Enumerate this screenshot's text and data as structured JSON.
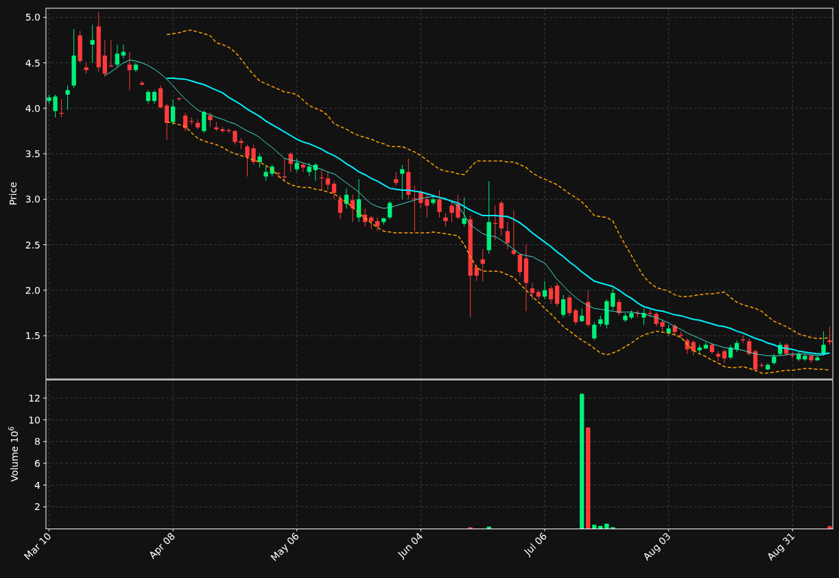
{
  "price_panel": {
    "chart_data": {
      "type": "candlestick",
      "ylabel": "Price",
      "grid": true,
      "ylim": [
        1.025,
        5.1
      ],
      "categories": [
        null,
        null,
        null,
        null,
        null,
        null,
        null,
        null,
        null,
        null,
        null,
        null,
        null,
        null,
        null,
        null,
        null,
        null,
        null,
        null,
        null,
        null,
        null,
        null,
        null,
        null,
        null,
        null,
        null,
        null,
        null,
        null,
        null,
        null,
        null,
        null,
        null,
        null,
        null,
        null,
        null,
        null,
        null,
        null,
        null,
        null,
        null,
        null,
        null,
        null,
        null,
        null,
        null,
        null,
        null,
        null,
        null,
        null,
        null,
        null,
        null,
        null,
        null,
        null,
        null,
        null,
        null,
        null,
        null,
        null,
        null,
        null,
        null,
        null,
        null,
        null,
        null,
        null,
        null,
        null,
        null,
        null,
        null,
        null,
        null,
        null,
        null,
        null,
        null,
        null,
        null,
        null,
        null,
        null,
        null,
        null,
        null,
        null,
        null,
        null,
        null,
        null,
        null,
        null,
        null,
        null,
        null,
        null,
        null,
        null,
        null,
        null,
        null,
        null,
        null,
        null,
        null,
        null,
        null,
        null,
        null,
        null,
        null,
        null,
        null,
        null,
        null
      ],
      "yticks": [
        {
          "value": 1.5,
          "label": "1.5"
        },
        {
          "value": 2,
          "label": "2.0"
        },
        {
          "value": 2.5,
          "label": "2.5"
        },
        {
          "value": 3,
          "label": "3.0"
        },
        {
          "value": 3.5,
          "label": "3.5"
        },
        {
          "value": 4,
          "label": "4.0"
        },
        {
          "value": 4.5,
          "label": "4.5"
        },
        {
          "value": 5,
          "label": "5.0"
        }
      ],
      "ohlc": [
        [
          4.08,
          4.15,
          4.05,
          4.12
        ],
        [
          3.97,
          4.15,
          3.9,
          4.13
        ],
        [
          3.95,
          4.1,
          3.9,
          3.94
        ],
        [
          4.15,
          4.25,
          3.98,
          4.2
        ],
        [
          4.25,
          4.87,
          4.22,
          4.58
        ],
        [
          4.8,
          4.85,
          4.5,
          4.52
        ],
        [
          4.45,
          4.5,
          4.38,
          4.42
        ],
        [
          4.7,
          4.92,
          4.5,
          4.75
        ],
        [
          4.9,
          5.06,
          4.4,
          4.45
        ],
        [
          4.58,
          4.75,
          4.35,
          4.38
        ],
        [
          4.47,
          4.75,
          4.45,
          4.46
        ],
        [
          4.48,
          4.7,
          4.45,
          4.6
        ],
        [
          4.58,
          4.7,
          4.55,
          4.62
        ],
        [
          4.48,
          4.62,
          4.2,
          4.42
        ],
        [
          4.42,
          4.5,
          4.4,
          4.48
        ],
        [
          4.28,
          4.3,
          4.25,
          4.26
        ],
        [
          4.08,
          4.2,
          4.05,
          4.18
        ],
        [
          4.08,
          4.2,
          4.05,
          4.18
        ],
        [
          4.22,
          4.25,
          4.0,
          4.01
        ],
        [
          4.03,
          4.05,
          3.65,
          3.84
        ],
        [
          3.85,
          4.1,
          3.82,
          4.02
        ],
        [
          4.11,
          4.12,
          4.08,
          4.1
        ],
        [
          3.92,
          3.95,
          3.75,
          3.78
        ],
        [
          3.86,
          3.9,
          3.82,
          3.85
        ],
        [
          3.84,
          3.88,
          3.77,
          3.79
        ],
        [
          3.75,
          3.98,
          3.73,
          3.96
        ],
        [
          3.92,
          3.95,
          3.8,
          3.87
        ],
        [
          3.79,
          3.85,
          3.75,
          3.77
        ],
        [
          3.77,
          3.8,
          3.73,
          3.75
        ],
        [
          3.76,
          3.78,
          3.73,
          3.75
        ],
        [
          3.75,
          3.76,
          3.6,
          3.63
        ],
        [
          3.64,
          3.67,
          3.55,
          3.62
        ],
        [
          3.58,
          3.6,
          3.25,
          3.47
        ],
        [
          3.56,
          3.6,
          3.38,
          3.41
        ],
        [
          3.41,
          3.5,
          3.35,
          3.47
        ],
        [
          3.25,
          3.38,
          3.2,
          3.3
        ],
        [
          3.28,
          3.38,
          3.25,
          3.36
        ],
        [
          3.29,
          3.3,
          3.23,
          3.28
        ],
        [
          3.25,
          3.45,
          3.2,
          3.24
        ],
        [
          3.5,
          3.52,
          3.3,
          3.39
        ],
        [
          3.33,
          3.45,
          3.3,
          3.4
        ],
        [
          3.38,
          3.4,
          3.3,
          3.35
        ],
        [
          3.3,
          3.4,
          3.25,
          3.36
        ],
        [
          3.32,
          3.4,
          3.2,
          3.38
        ],
        [
          3.24,
          3.33,
          3.1,
          3.23
        ],
        [
          3.23,
          3.3,
          3.1,
          3.16
        ],
        [
          3.17,
          3.2,
          3.0,
          3.07
        ],
        [
          3.0,
          3.05,
          2.78,
          2.85
        ],
        [
          2.95,
          3.12,
          2.9,
          3.05
        ],
        [
          2.99,
          3.05,
          2.75,
          2.9
        ],
        [
          2.8,
          3.22,
          2.75,
          3.0
        ],
        [
          2.83,
          2.9,
          2.7,
          2.75
        ],
        [
          2.8,
          2.82,
          2.67,
          2.76
        ],
        [
          2.76,
          2.8,
          2.65,
          2.7
        ],
        [
          2.75,
          2.8,
          2.72,
          2.79
        ],
        [
          2.8,
          2.98,
          2.78,
          2.96
        ],
        [
          3.22,
          3.3,
          3.15,
          3.18
        ],
        [
          3.28,
          3.38,
          3.0,
          3.33
        ],
        [
          3.3,
          3.45,
          3.0,
          3.05
        ],
        [
          3.01,
          3.15,
          2.65,
          3.0
        ],
        [
          3.08,
          3.1,
          2.9,
          2.96
        ],
        [
          3.0,
          3.05,
          2.8,
          2.93
        ],
        [
          2.96,
          3.05,
          2.94,
          3.0
        ],
        [
          3.0,
          3.1,
          2.8,
          2.86
        ],
        [
          2.8,
          2.85,
          2.7,
          2.76
        ],
        [
          2.93,
          2.98,
          2.75,
          2.85
        ],
        [
          2.95,
          3.05,
          2.78,
          2.8
        ],
        [
          2.73,
          3.02,
          2.7,
          2.79
        ],
        [
          2.78,
          2.82,
          1.7,
          2.16
        ],
        [
          2.25,
          2.28,
          2.1,
          2.16
        ],
        [
          2.34,
          2.45,
          2.1,
          2.29
        ],
        [
          2.44,
          3.2,
          2.4,
          2.75
        ],
        [
          2.74,
          2.93,
          2.55,
          2.73
        ],
        [
          2.96,
          2.98,
          2.6,
          2.68
        ],
        [
          2.65,
          2.75,
          2.45,
          2.52
        ],
        [
          2.44,
          2.88,
          2.38,
          2.4
        ],
        [
          2.39,
          2.4,
          2.15,
          2.2
        ],
        [
          2.35,
          2.5,
          1.77,
          2.08
        ],
        [
          2.02,
          2.08,
          1.9,
          1.97
        ],
        [
          1.98,
          2.0,
          1.9,
          1.93
        ],
        [
          1.93,
          2.1,
          1.9,
          2.0
        ],
        [
          2.02,
          2.05,
          1.85,
          1.9
        ],
        [
          2.05,
          2.08,
          1.82,
          1.85
        ],
        [
          1.73,
          1.95,
          1.7,
          1.9
        ],
        [
          1.92,
          1.95,
          1.72,
          1.75
        ],
        [
          1.78,
          1.8,
          1.62,
          1.65
        ],
        [
          1.66,
          1.8,
          1.65,
          1.72
        ],
        [
          1.87,
          2.0,
          1.6,
          1.62
        ],
        [
          1.47,
          1.65,
          1.45,
          1.62
        ],
        [
          1.63,
          1.72,
          1.6,
          1.68
        ],
        [
          1.62,
          1.9,
          1.58,
          1.88
        ],
        [
          1.82,
          2.02,
          1.78,
          1.97
        ],
        [
          1.87,
          1.9,
          1.72,
          1.75
        ],
        [
          1.67,
          1.75,
          1.65,
          1.72
        ],
        [
          1.7,
          1.78,
          1.68,
          1.75
        ],
        [
          1.75,
          1.78,
          1.7,
          1.74
        ],
        [
          1.7,
          1.8,
          1.62,
          1.75
        ],
        [
          1.75,
          1.8,
          1.7,
          1.74
        ],
        [
          1.74,
          1.76,
          1.6,
          1.63
        ],
        [
          1.65,
          1.68,
          1.55,
          1.6
        ],
        [
          1.53,
          1.62,
          1.5,
          1.58
        ],
        [
          1.61,
          1.63,
          1.5,
          1.54
        ],
        [
          1.51,
          1.55,
          1.47,
          1.5
        ],
        [
          1.45,
          1.47,
          1.3,
          1.35
        ],
        [
          1.43,
          1.45,
          1.28,
          1.33
        ],
        [
          1.34,
          1.4,
          1.3,
          1.37
        ],
        [
          1.36,
          1.43,
          1.35,
          1.4
        ],
        [
          1.4,
          1.42,
          1.3,
          1.32
        ],
        [
          1.3,
          1.33,
          1.22,
          1.27
        ],
        [
          1.33,
          1.35,
          1.2,
          1.25
        ],
        [
          1.26,
          1.4,
          1.24,
          1.37
        ],
        [
          1.35,
          1.45,
          1.32,
          1.42
        ],
        [
          1.46,
          1.5,
          1.42,
          1.45
        ],
        [
          1.44,
          1.47,
          1.28,
          1.3
        ],
        [
          1.33,
          1.35,
          1.1,
          1.13
        ],
        [
          1.18,
          1.2,
          1.15,
          1.17
        ],
        [
          1.13,
          1.2,
          1.12,
          1.18
        ],
        [
          1.2,
          1.3,
          1.18,
          1.27
        ],
        [
          1.3,
          1.43,
          1.28,
          1.4
        ],
        [
          1.4,
          1.42,
          1.28,
          1.3
        ],
        [
          1.29,
          1.32,
          1.25,
          1.28
        ],
        [
          1.24,
          1.32,
          1.22,
          1.3
        ],
        [
          1.24,
          1.3,
          1.22,
          1.28
        ],
        [
          1.28,
          1.3,
          1.2,
          1.23
        ],
        [
          1.23,
          1.28,
          1.22,
          1.26
        ],
        [
          1.3,
          1.55,
          1.28,
          1.4
        ],
        [
          1.45,
          1.6,
          1.4,
          1.43
        ]
      ],
      "series": [
        {
          "type": "line",
          "color": "#40e0d0",
          "values": [
            null,
            null,
            null,
            null,
            null,
            null,
            null,
            null,
            null,
            4.36,
            4.4,
            4.45,
            4.5,
            4.53,
            4.52,
            4.5,
            4.47,
            4.43,
            4.38,
            4.32,
            4.25,
            4.17,
            4.1,
            4.04,
            3.98,
            3.95,
            3.93,
            3.9,
            3.88,
            3.85,
            3.83,
            3.79,
            3.75,
            3.72,
            3.68,
            3.62,
            3.57,
            3.51,
            3.45,
            3.43,
            3.42,
            3.4,
            3.38,
            3.35,
            3.33,
            3.3,
            3.28,
            3.23,
            3.18,
            3.13,
            3.08,
            3.01,
            2.95,
            2.92,
            2.9,
            2.91,
            2.93,
            2.95,
            2.97,
            2.99,
            3.01,
            3.02,
            3.03,
            3.02,
            3.01,
            2.97,
            2.93,
            2.83,
            2.72,
            2.67,
            2.62,
            2.6,
            2.59,
            2.55,
            2.5,
            2.45,
            2.4,
            2.38,
            2.37,
            2.33,
            2.3,
            2.21,
            2.12,
            2.05,
            1.98,
            1.92,
            1.87,
            1.83,
            1.8,
            1.79,
            1.78,
            1.77,
            1.76,
            1.76,
            1.76,
            1.75,
            1.74,
            1.72,
            1.7,
            1.67,
            1.64,
            1.6,
            1.57,
            1.53,
            1.5,
            1.47,
            1.44,
            1.41,
            1.39,
            1.37,
            1.36,
            1.35,
            1.34,
            1.32,
            1.3,
            1.29,
            1.28,
            1.28,
            1.28,
            1.29,
            1.3,
            1.3,
            1.3,
            1.29,
            1.28,
            1.29,
            1.31
          ]
        },
        {
          "type": "line",
          "color": "#00f0ff",
          "values": [
            null,
            null,
            null,
            null,
            null,
            null,
            null,
            null,
            null,
            null,
            null,
            null,
            null,
            null,
            null,
            null,
            null,
            null,
            null,
            4.33,
            4.33,
            4.325,
            4.32,
            4.3,
            4.28,
            4.26,
            4.23,
            4.2,
            4.17,
            4.12,
            4.08,
            4.04,
            3.99,
            3.95,
            3.91,
            3.86,
            3.82,
            3.78,
            3.74,
            3.7,
            3.66,
            3.63,
            3.61,
            3.58,
            3.55,
            3.51,
            3.48,
            3.44,
            3.39,
            3.35,
            3.3,
            3.27,
            3.23,
            3.2,
            3.16,
            3.12,
            3.11,
            3.1,
            3.1,
            3.09,
            3.08,
            3.06,
            3.04,
            3.02,
            3.0,
            2.98,
            2.96,
            2.92,
            2.88,
            2.85,
            2.82,
            2.82,
            2.82,
            2.815,
            2.81,
            2.78,
            2.74,
            2.69,
            2.63,
            2.58,
            2.53,
            2.48,
            2.42,
            2.37,
            2.31,
            2.26,
            2.2,
            2.15,
            2.1,
            2.08,
            2.06,
            2.04,
            2.0,
            1.95,
            1.91,
            1.86,
            1.82,
            1.8,
            1.78,
            1.77,
            1.75,
            1.73,
            1.72,
            1.7,
            1.68,
            1.67,
            1.65,
            1.63,
            1.61,
            1.6,
            1.58,
            1.55,
            1.53,
            1.5,
            1.47,
            1.45,
            1.42,
            1.4,
            1.37,
            1.36,
            1.35,
            1.33,
            1.32,
            1.31,
            1.3,
            1.3,
            1.31
          ]
        },
        {
          "type": "line",
          "color": "#ffa500",
          "line_style": "dashed",
          "values": [
            null,
            null,
            null,
            null,
            null,
            null,
            null,
            null,
            null,
            null,
            null,
            null,
            null,
            null,
            null,
            null,
            null,
            null,
            null,
            4.81,
            4.82,
            4.83,
            4.85,
            4.86,
            4.84,
            4.82,
            4.8,
            4.72,
            4.7,
            4.67,
            4.62,
            4.54,
            4.45,
            4.37,
            4.3,
            4.27,
            4.24,
            4.21,
            4.18,
            4.17,
            4.15,
            4.09,
            4.03,
            4.0,
            3.97,
            3.92,
            3.83,
            3.8,
            3.77,
            3.73,
            3.7,
            3.68,
            3.66,
            3.63,
            3.61,
            3.58,
            3.58,
            3.58,
            3.55,
            3.52,
            3.48,
            3.43,
            3.38,
            3.33,
            3.31,
            3.3,
            3.28,
            3.27,
            3.35,
            3.42,
            3.42,
            3.42,
            3.42,
            3.42,
            3.41,
            3.41,
            3.38,
            3.35,
            3.29,
            3.25,
            3.22,
            3.19,
            3.16,
            3.11,
            3.06,
            3.02,
            2.97,
            2.9,
            2.82,
            2.81,
            2.8,
            2.76,
            2.62,
            2.5,
            2.38,
            2.26,
            2.15,
            2.08,
            2.03,
            2.01,
            1.99,
            1.95,
            1.93,
            1.93,
            1.94,
            1.95,
            1.96,
            1.96,
            1.97,
            1.98,
            1.92,
            1.87,
            1.84,
            1.82,
            1.8,
            1.77,
            1.71,
            1.66,
            1.63,
            1.6,
            1.56,
            1.52,
            1.5,
            1.48,
            1.47,
            1.47,
            1.48
          ]
        },
        {
          "type": "line",
          "color": "#ffa500",
          "line_style": "dashed",
          "values": [
            null,
            null,
            null,
            null,
            null,
            null,
            null,
            null,
            null,
            null,
            null,
            null,
            null,
            null,
            null,
            null,
            null,
            null,
            null,
            3.85,
            3.84,
            3.82,
            3.8,
            3.73,
            3.67,
            3.64,
            3.62,
            3.6,
            3.57,
            3.53,
            3.5,
            3.48,
            3.46,
            3.43,
            3.41,
            3.37,
            3.33,
            3.26,
            3.2,
            3.16,
            3.14,
            3.13,
            3.13,
            3.11,
            3.1,
            3.08,
            3.06,
            3.01,
            2.97,
            2.91,
            2.85,
            2.79,
            2.74,
            2.69,
            2.65,
            2.64,
            2.63,
            2.63,
            2.63,
            2.63,
            2.63,
            2.63,
            2.64,
            2.63,
            2.62,
            2.61,
            2.6,
            2.5,
            2.37,
            2.25,
            2.21,
            2.21,
            2.21,
            2.2,
            2.17,
            2.14,
            2.07,
            2.0,
            1.93,
            1.87,
            1.8,
            1.74,
            1.67,
            1.6,
            1.55,
            1.5,
            1.45,
            1.41,
            1.36,
            1.31,
            1.29,
            1.31,
            1.34,
            1.38,
            1.42,
            1.47,
            1.51,
            1.53,
            1.55,
            1.54,
            1.53,
            1.51,
            1.48,
            1.41,
            1.34,
            1.3,
            1.27,
            1.23,
            1.2,
            1.16,
            1.15,
            1.15,
            1.16,
            1.14,
            1.12,
            1.09,
            1.09,
            1.1,
            1.11,
            1.12,
            1.12,
            1.13,
            1.14,
            1.14,
            1.13,
            1.13,
            1.12
          ]
        }
      ]
    }
  },
  "volume_panel": {
    "chart_data": {
      "type": "bar",
      "ylabel": "Volume  10$^{6}$",
      "grid": true,
      "ylim": [
        0,
        13.7
      ],
      "categories": [
        "Mar 10",
        null,
        null,
        null,
        null,
        null,
        null,
        null,
        null,
        null,
        null,
        null,
        null,
        null,
        null,
        null,
        null,
        null,
        null,
        null,
        "Apr 08",
        null,
        null,
        null,
        null,
        null,
        null,
        null,
        null,
        null,
        null,
        null,
        null,
        null,
        null,
        null,
        null,
        null,
        null,
        null,
        "May 06",
        null,
        null,
        null,
        null,
        null,
        null,
        null,
        null,
        null,
        null,
        null,
        null,
        null,
        null,
        null,
        null,
        null,
        null,
        null,
        "Jun 04",
        null,
        null,
        null,
        null,
        null,
        null,
        null,
        null,
        null,
        null,
        null,
        null,
        null,
        null,
        null,
        null,
        null,
        null,
        null,
        "Jul 06",
        null,
        null,
        null,
        null,
        null,
        null,
        null,
        null,
        null,
        null,
        null,
        null,
        null,
        null,
        null,
        null,
        null,
        null,
        null,
        "Aug 03",
        null,
        null,
        null,
        null,
        null,
        null,
        null,
        null,
        null,
        null,
        null,
        null,
        null,
        null,
        null,
        null,
        null,
        null,
        null,
        "Aug 31",
        null,
        null,
        null,
        null,
        null,
        null
      ],
      "yticks": [
        {
          "value": 2,
          "label": "2"
        },
        {
          "value": 4,
          "label": "4"
        },
        {
          "value": 6,
          "label": "6"
        },
        {
          "value": 8,
          "label": "8"
        },
        {
          "value": 10,
          "label": "10"
        },
        {
          "value": 12,
          "label": "12"
        }
      ],
      "series": [
        {
          "values": [
            null,
            null,
            null,
            null,
            null,
            null,
            null,
            null,
            null,
            null,
            null,
            null,
            null,
            null,
            null,
            null,
            null,
            null,
            null,
            null,
            null,
            null,
            null,
            null,
            null,
            null,
            null,
            null,
            null,
            null,
            null,
            null,
            null,
            null,
            null,
            null,
            null,
            null,
            null,
            null,
            null,
            null,
            null,
            null,
            null,
            null,
            null,
            null,
            null,
            null,
            null,
            null,
            null,
            null,
            null,
            null,
            null,
            null,
            null,
            null,
            null,
            null,
            null,
            null,
            null,
            null,
            null,
            null,
            0.12,
            null,
            null,
            0.18,
            null,
            null,
            null,
            null,
            null,
            null,
            null,
            null,
            null,
            null,
            null,
            null,
            null,
            null,
            12.4,
            9.3,
            0.35,
            0.25,
            0.45,
            0.12,
            null,
            null,
            null,
            null,
            null,
            null,
            null,
            null,
            null,
            null,
            null,
            null,
            null,
            null,
            null,
            null,
            null,
            null,
            null,
            null,
            null,
            null,
            null,
            null,
            null,
            null,
            null,
            null,
            null,
            null,
            null,
            null,
            null,
            null,
            0.22
          ]
        }
      ]
    }
  }
}
